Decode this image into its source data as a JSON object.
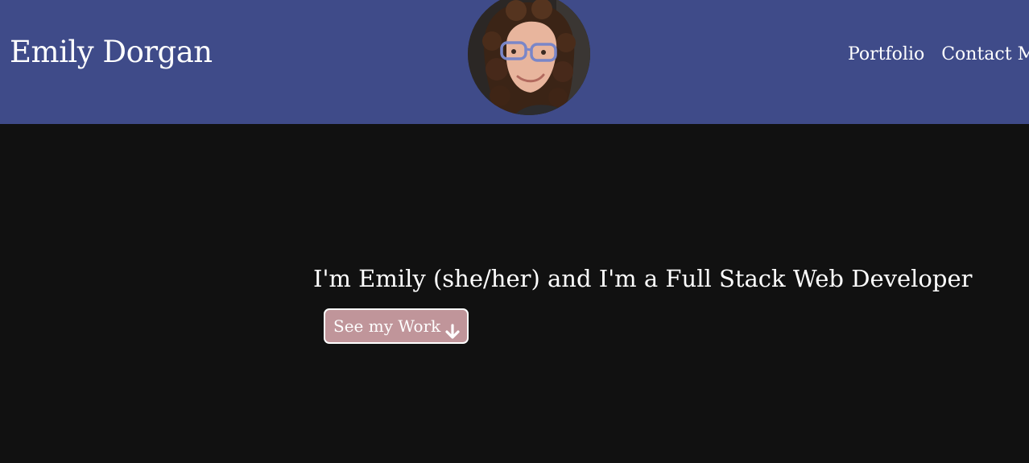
{
  "header": {
    "site_title": "Emily Dorgan",
    "avatar_alt": "Emily Dorgan",
    "nav": [
      {
        "label": "Portfolio"
      },
      {
        "label": "Contact Me"
      }
    ]
  },
  "hero": {
    "heading": "I'm Emily (she/her) and I'm a Full Stack Web Developer",
    "cta_label": "See my Work",
    "cta_icon": "arrow-down-icon"
  },
  "colors": {
    "header_bg": "#3f4b89",
    "page_bg": "#111111",
    "button_bg": "#c0959a",
    "text": "#ffffff"
  }
}
